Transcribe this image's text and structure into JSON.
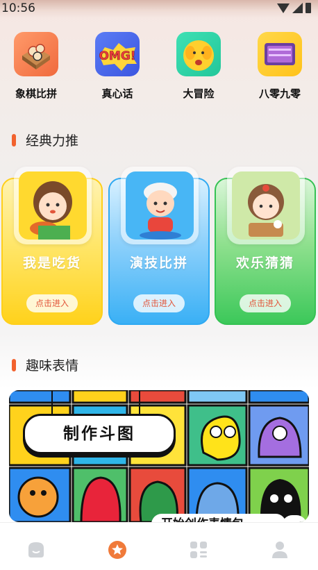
{
  "status": {
    "time": "10:56"
  },
  "games": [
    {
      "label": "象棋比拼",
      "icon": "chess-icon"
    },
    {
      "label": "真心话",
      "icon": "omg-icon"
    },
    {
      "label": "大冒险",
      "icon": "shy-face-icon"
    },
    {
      "label": "八零九零",
      "icon": "retro-tv-icon"
    }
  ],
  "sections": {
    "classic": "经典力推",
    "emoji": "趣味表情"
  },
  "cards": [
    {
      "title": "我是吃货",
      "button": "点击进入"
    },
    {
      "title": "演技比拼",
      "button": "点击进入"
    },
    {
      "title": "欢乐猜猜",
      "button": "点击进入"
    }
  ],
  "banner": {
    "title": "制作斗图",
    "subtitle": "开始创作表情包",
    "arrow": "›"
  },
  "tabs": [
    {
      "name": "home-tab",
      "icon": "home-icon"
    },
    {
      "name": "fun-tab",
      "icon": "star-badge-icon",
      "active": true
    },
    {
      "name": "apps-tab",
      "icon": "grid-icon"
    },
    {
      "name": "profile-tab",
      "icon": "person-icon"
    }
  ],
  "colors": {
    "accent": "#f2622e",
    "card_yellow": "#ffd21c",
    "card_blue": "#3ab0f5",
    "card_green": "#3cc85a"
  }
}
